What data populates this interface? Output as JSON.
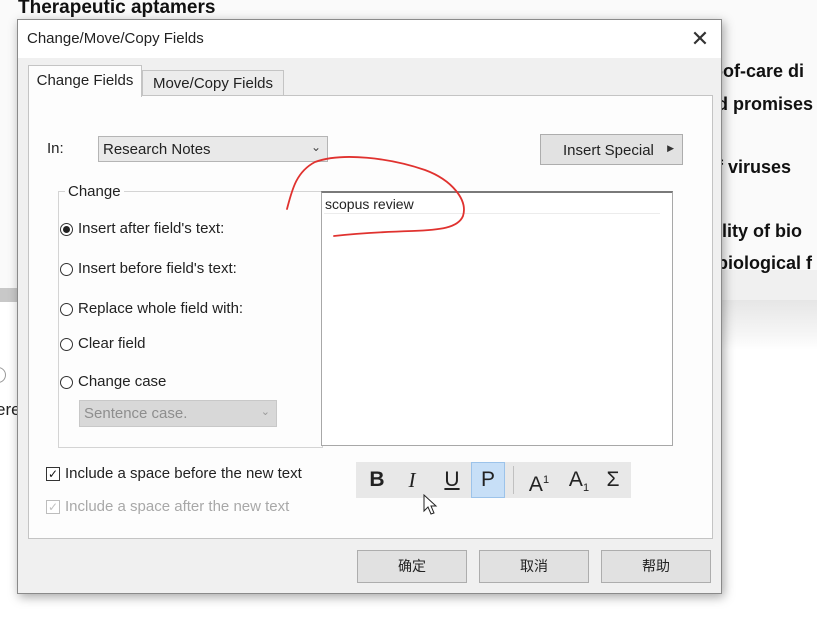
{
  "background_doc": {
    "heading": "Therapeutic aptamers",
    "lines": [
      "-of-care di",
      "d promises",
      "f viruses",
      "ility of bio",
      "biological f"
    ],
    "left_fragment": "ere"
  },
  "dialog": {
    "title": "Change/Move/Copy Fields",
    "close_icon": "✕",
    "tabs": [
      {
        "label": "Change Fields",
        "active": true
      },
      {
        "label": "Move/Copy Fields",
        "active": false
      }
    ],
    "in_label": "In:",
    "in_select": {
      "value": "Research Notes"
    },
    "insert_special_label": "Insert Special",
    "change_group": {
      "legend": "Change",
      "options": [
        {
          "label": "Insert after field's text:",
          "checked": true
        },
        {
          "label": "Insert before field's text:",
          "checked": false
        },
        {
          "label": "Replace whole field with:",
          "checked": false
        },
        {
          "label": "Clear field",
          "checked": false
        },
        {
          "label": "Change case",
          "checked": false
        }
      ],
      "case_select": {
        "value": "Sentence case.",
        "disabled": true
      }
    },
    "text_value": "scopus review",
    "checkboxes": [
      {
        "label": "Include a space before the new text",
        "checked": true,
        "disabled": false
      },
      {
        "label": "Include a space after the new text",
        "checked": true,
        "disabled": true
      }
    ],
    "format_toolbar": {
      "bold": "B",
      "italic": "I",
      "underline": "U",
      "plain": "P",
      "superscript": "A",
      "superscript_mark": "1",
      "subscript": "A",
      "subscript_mark": "1",
      "symbol": "Σ",
      "active_button": "plain"
    },
    "buttons": {
      "ok": "确定",
      "cancel": "取消",
      "help": "帮助"
    }
  },
  "annotation": {
    "color": "#e0322f",
    "kind": "hand-drawn circle"
  }
}
